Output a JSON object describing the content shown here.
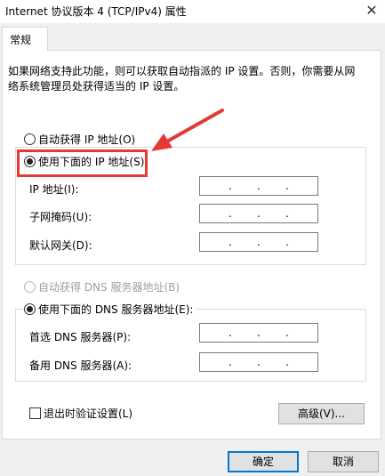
{
  "window": {
    "title": "Internet 协议版本 4 (TCP/IPv4) 属性",
    "close_symbol": "✕"
  },
  "tab": {
    "label": "常规"
  },
  "description": {
    "line1": "如果网络支持此功能，则可以获取自动指派的 IP 设置。否则，你需要从网",
    "line2": "络系统管理员处获得适当的 IP 设置。"
  },
  "ip_section": {
    "auto_label": "自动获得 IP 地址(O)",
    "manual_label": "使用下面的 IP 地址(S):",
    "selected": "manual",
    "fields": [
      {
        "label": "IP 地址(I):",
        "value": ""
      },
      {
        "label": "子网掩码(U):",
        "value": ""
      },
      {
        "label": "默认网关(D):",
        "value": ""
      }
    ]
  },
  "dns_section": {
    "auto_label": "自动获得 DNS 服务器地址(B)",
    "auto_disabled": true,
    "manual_label": "使用下面的 DNS 服务器地址(E):",
    "selected": "manual",
    "fields": [
      {
        "label": "首选 DNS 服务器(P):",
        "value": ""
      },
      {
        "label": "备用 DNS 服务器(A):",
        "value": ""
      }
    ]
  },
  "validate_on_exit": {
    "label": "退出时验证设置(L)",
    "checked": false
  },
  "buttons": {
    "advanced": "高级(V)...",
    "ok": "确定",
    "cancel": "取消"
  },
  "annotation": {
    "color": "#e53935"
  },
  "icons": {
    "close": "close-icon",
    "arrow": "red-arrow-icon"
  }
}
